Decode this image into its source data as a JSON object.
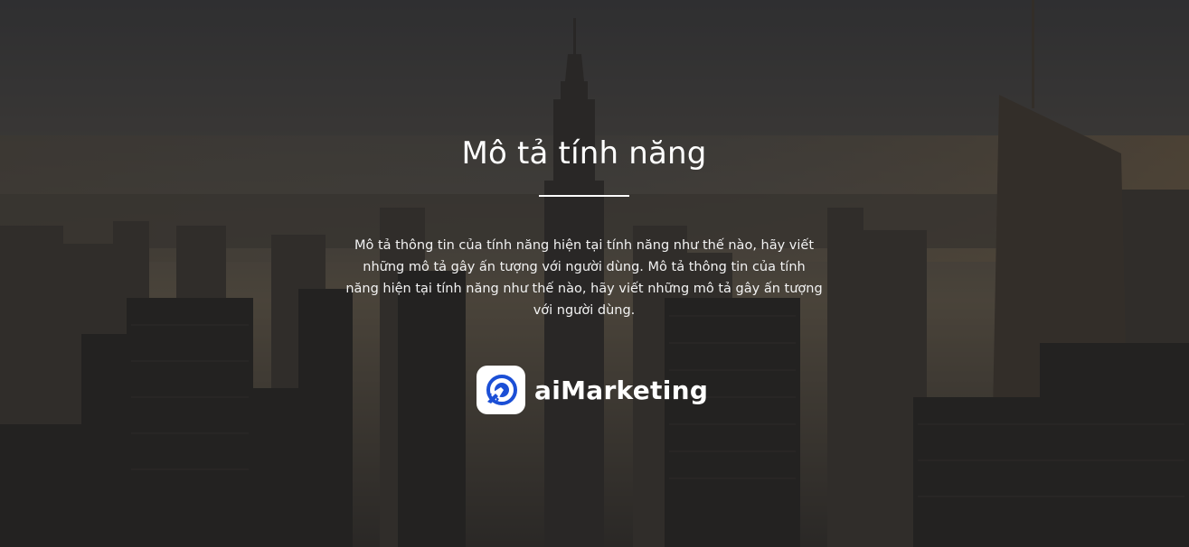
{
  "feature": {
    "title": "Mô tả tính năng",
    "description": "Mô tả thông tin của tính năng hiện tại tính năng như thế nào, hãy viết những mô tả gây ấn tượng với người dùng. Mô tả thông tin của tính năng hiện tại tính năng như thế nào, hãy viết những mô tả gây ấn tượng với người dùng."
  },
  "brand": {
    "name": "aiMarketing",
    "icon": "rocket-target-icon",
    "accent_color": "#1b4fd6"
  },
  "background": {
    "subject": "city-skyline-image",
    "overlay_color": "#1c1c1e"
  }
}
